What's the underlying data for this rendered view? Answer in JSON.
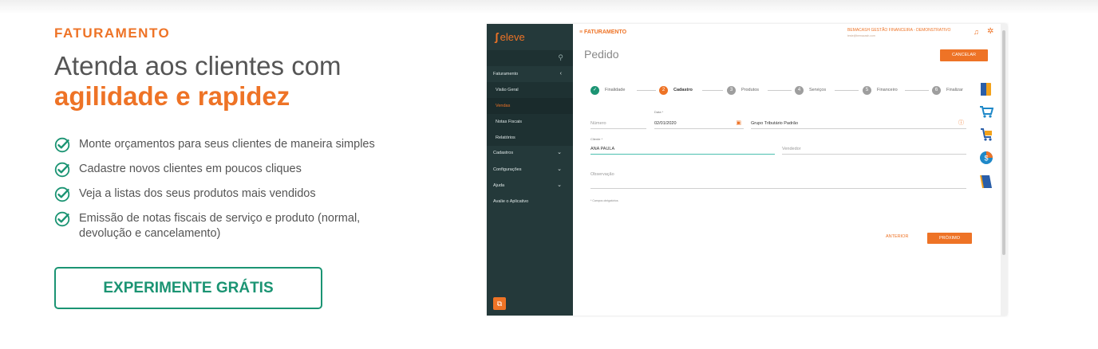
{
  "marketing": {
    "eyebrow": "FATURAMENTO",
    "headline_main": "Atenda aos clientes com",
    "headline_accent": "agilidade e rapidez",
    "features": [
      "Monte orçamentos para seus clientes de maneira simples",
      "Cadastre novos clientes em poucos cliques",
      "Veja a listas dos seus produtos mais vendidos",
      "Emissão de notas fiscais de serviço e produto (normal, devolução e cancelamento)"
    ],
    "cta_label": "EXPERIMENTE GRÁTIS",
    "accent_color": "#ee7326",
    "cta_color": "#1b9473"
  },
  "app": {
    "logo_text": "eleve",
    "sidebar": {
      "items": [
        {
          "label": "Faturamento",
          "icon": "chevron-left-icon"
        },
        {
          "label": "Visão Geral"
        },
        {
          "label": "Vendas"
        },
        {
          "label": "Notas Fiscais"
        },
        {
          "label": "Relatórios"
        },
        {
          "label": "Cadastros",
          "icon": "chevron-down-icon"
        },
        {
          "label": "Configurações",
          "icon": "chevron-down-icon"
        },
        {
          "label": "Ajuda",
          "icon": "chevron-down-icon"
        },
        {
          "label": "Avalie o Aplicativo"
        }
      ]
    },
    "topbar": {
      "title": "≡ FATURAMENTO",
      "company": "BEMACASH GESTÃO FINANCEIRA - DEMONSTRATIVO",
      "company_sub": "teste@bemacash.com"
    },
    "page_title": "Pedido",
    "cancel_label": "CANCELAR",
    "steps": [
      {
        "label": "Finalidade",
        "marker": "✓",
        "state": "done"
      },
      {
        "label": "Cadastro",
        "marker": "2",
        "state": "active"
      },
      {
        "label": "Produtos",
        "marker": "3",
        "state": "todo"
      },
      {
        "label": "Serviços",
        "marker": "4",
        "state": "todo"
      },
      {
        "label": "Financeiro",
        "marker": "5",
        "state": "todo"
      },
      {
        "label": "Finalizar",
        "marker": "6",
        "state": "todo"
      }
    ],
    "form": {
      "numero_placeholder": "Número",
      "data_label": "Data *",
      "data_value": "02/01/2020",
      "grupo_value": "Grupo Tributário Padrão",
      "cliente_label": "Cliente *",
      "cliente_value": "ANA PAULA",
      "vendedor_placeholder": "Vendedor",
      "observacao_placeholder": "Observação",
      "required_note": "* Campos obrigatórios"
    },
    "prev_label": "ANTERIOR",
    "next_label": "PRÓXIMO"
  }
}
